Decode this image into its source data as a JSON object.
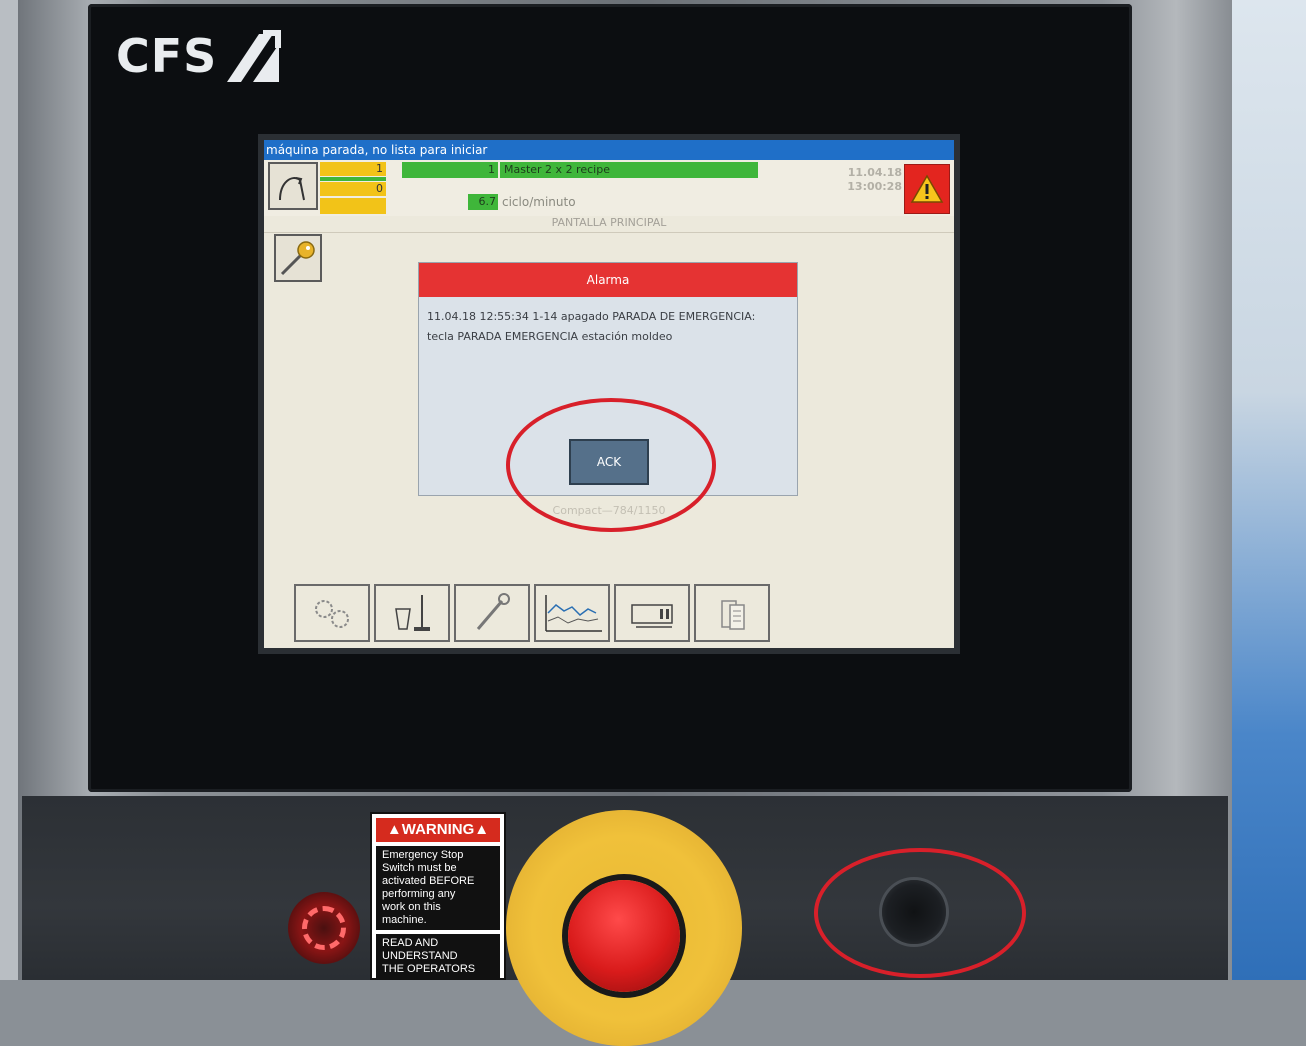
{
  "brand": {
    "logo_text": "CFS"
  },
  "screen": {
    "status_message": "máquina parada, no lista para iniciar",
    "counter_top": "1",
    "counter_bottom": "0",
    "batch_count": "1",
    "recipe_name": "Master 2 x 2 recipe",
    "speed_value": "6.7",
    "speed_unit": "ciclo/minuto",
    "date": "11.04.18",
    "time": "13:00:28",
    "screen_title": "PANTALLA PRINCIPAL",
    "footer_text": "Compact—784/1150",
    "colors": {
      "titlebar": "#1f6fc8",
      "alarm": "#e53333",
      "ok": "#3fb63a",
      "warn": "#f2c318"
    }
  },
  "alarm_dialog": {
    "title": "Alarma",
    "message_line1": "11.04.18 12:55:34 1-14 apagado PARADA DE EMERGENCIA:",
    "message_line2": "tecla PARADA EMERGENCIA estación moldeo",
    "ack_label": "ACK"
  },
  "toolbar": {
    "items": [
      {
        "icon": "gears-icon"
      },
      {
        "icon": "cleaning-icon"
      },
      {
        "icon": "wrench-icon"
      },
      {
        "icon": "trend-chart-icon"
      },
      {
        "icon": "monitor-icon"
      },
      {
        "icon": "documents-icon"
      }
    ]
  },
  "warning_label": {
    "heading": "WARNING",
    "lines": [
      "Emergency Stop",
      "Switch must be",
      "activated BEFORE",
      "performing any",
      "work on this",
      "machine."
    ],
    "lines2": [
      "READ AND",
      "UNDERSTAND",
      "THE OPERATORS"
    ]
  }
}
